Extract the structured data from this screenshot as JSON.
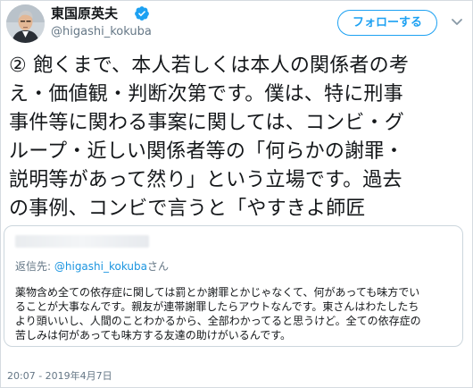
{
  "author": {
    "display_name": "東国原英夫",
    "handle": "@higashi_kokuba",
    "verified": true
  },
  "follow_button": {
    "label": "フォローする"
  },
  "tweet": {
    "lines": [
      "② 飽くまで、本人若しくは本人の関係者の考",
      "え・価値観・判断次第です。僕は、特に刑事",
      "事件等に関わる事案に関しては、コンビ・グ",
      "ループ・近しい関係者等の「何らかの謝罪・",
      "説明等があって然り」という立場です。過去",
      "の事例、コンビで言うと「やすきよ師匠"
    ]
  },
  "quoted_tweet": {
    "reply_prefix": "返信先:",
    "reply_handle": "@higashi_kokuba",
    "reply_suffix": "さん",
    "lines": [
      "薬物含め全ての依存症に関しては罰とか謝罪とかじゃなくて、何があっても味方でい",
      "ることが大事なんです。親友が連帯謝罪したらアウトなんです。東さんはわたしたち",
      "より頭いいし、人間のことわかるから、全部わかってると思うけど。全ての依存症の",
      "苦しみは何があっても味方する友達の助けがいるんです。"
    ]
  },
  "timestamp": "20:07 - 2019年4月7日",
  "colors": {
    "accent": "#1da1f2",
    "link": "#1b95e0",
    "secondary_text": "#657786",
    "border": "#ccd6dd"
  },
  "icons": [
    "verified-badge-icon",
    "chevron-down-icon"
  ]
}
